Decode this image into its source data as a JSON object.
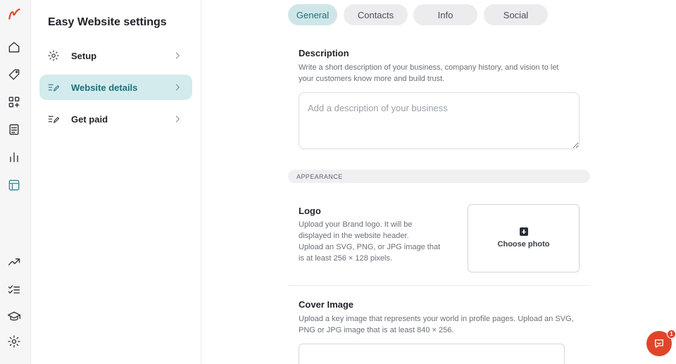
{
  "panel": {
    "title": "Easy Website settings",
    "items": [
      {
        "label": "Setup",
        "icon": "gear-icon",
        "active": false
      },
      {
        "label": "Website details",
        "icon": "edit-list-icon",
        "active": true
      },
      {
        "label": "Get paid",
        "icon": "edit-list-icon",
        "active": false
      }
    ]
  },
  "rail": {
    "icons": [
      "brand-logo",
      "home-icon",
      "tag-icon",
      "apps-icon",
      "document-icon",
      "analytics-icon",
      "website-icon",
      "trending-icon",
      "tasks-icon",
      "academy-icon",
      "settings-icon"
    ],
    "active_icon": "website-icon"
  },
  "tabs": [
    {
      "label": "General",
      "active": true
    },
    {
      "label": "Contacts",
      "active": false
    },
    {
      "label": "Info",
      "active": false
    },
    {
      "label": "Social",
      "active": false
    }
  ],
  "description": {
    "label": "Description",
    "help_line1": "Write a short description of your business, company history, and vision to let",
    "help_line2": "your customers know more and build trust.",
    "placeholder": "Add a description of your business",
    "value": ""
  },
  "appearance": {
    "section_label": "APPEARANCE",
    "logo": {
      "label": "Logo",
      "help_line1": "Upload your Brand logo. It will be",
      "help_line2": "displayed in the website header.",
      "help_line3": "Upload an SVG, PNG, or JPG image that",
      "help_line4": "is at least 256 × 128 pixels.",
      "upload_label": "Choose photo"
    },
    "cover": {
      "label": "Cover Image",
      "help_line1": "Upload a key image that represents your world in profile pages. Upload an SVG,",
      "help_line2": "PNG or JPG image that is at least 840 × 256."
    }
  },
  "chat": {
    "badge_count": "1"
  },
  "colors": {
    "accent": "#2a8c97",
    "accent_bg": "#d3ebed",
    "brand": "#e0452b"
  }
}
